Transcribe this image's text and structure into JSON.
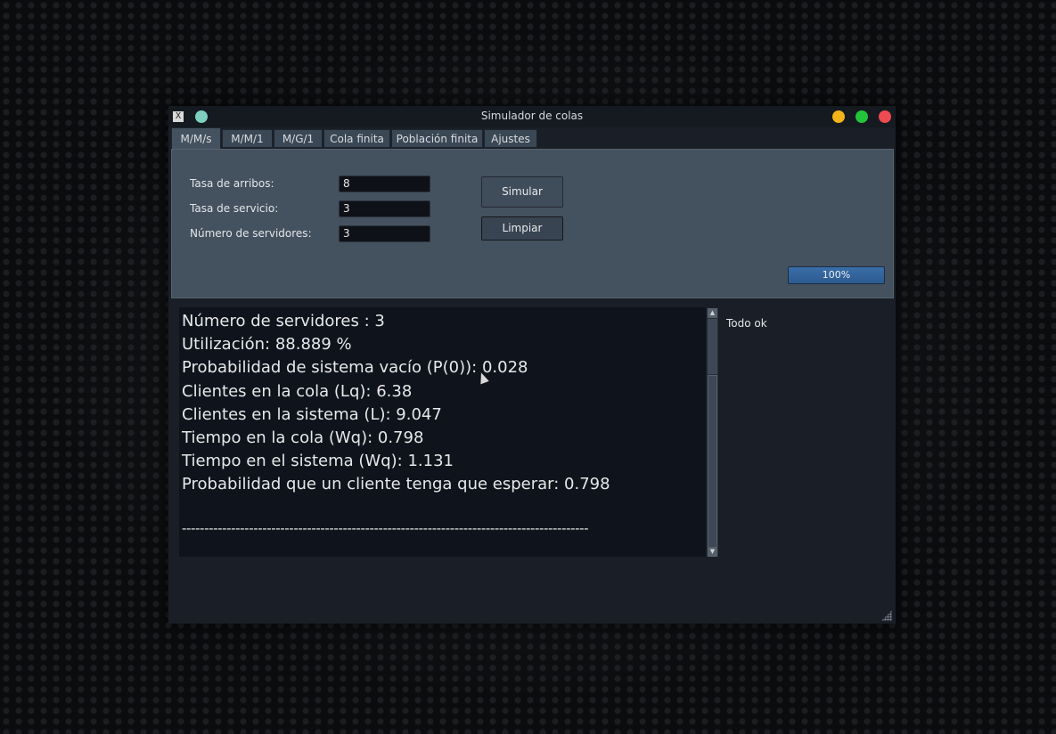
{
  "window": {
    "title": "Simulador de colas",
    "app_icon_glyph": "X",
    "buttons": [
      "minimize",
      "maximize",
      "close"
    ],
    "colors": {
      "minimize": "#f2b418",
      "maximize": "#23c43c",
      "close": "#ee4a52",
      "pin": "#7ecfc0"
    }
  },
  "tabs": [
    {
      "label": "M/M/s",
      "active": true
    },
    {
      "label": "M/M/1",
      "active": false
    },
    {
      "label": "M/G/1",
      "active": false
    },
    {
      "label": "Cola finita",
      "active": false
    },
    {
      "label": "Población finita",
      "active": false
    },
    {
      "label": "Ajustes",
      "active": false
    }
  ],
  "form": {
    "arrival_rate": {
      "label": "Tasa de arribos:",
      "value": "8"
    },
    "service_rate": {
      "label": "Tasa de servicio:",
      "value": "3"
    },
    "servers": {
      "label": "Número de servidores:",
      "value": "3"
    }
  },
  "actions": {
    "simulate": "Simular",
    "clear": "Limpiar"
  },
  "progress": {
    "value": 1.0,
    "label": "100%"
  },
  "output": {
    "lines": [
      "Número de servidores : 3",
      "Utilización: 88.889 %",
      "Probabilidad de sistema vacío (P(0)): 0.028",
      "Clientes en la cola (Lq): 6.38",
      "Clientes en la sistema (L): 9.047",
      "Tiempo en la cola (Wq): 0.798",
      "Tiempo en el sistema (Wq): 1.131",
      "Probabilidad que un cliente tenga que esperar: 0.798"
    ],
    "separator": "-------------------------------------------------------------------------------------------"
  },
  "status": "Todo ok"
}
